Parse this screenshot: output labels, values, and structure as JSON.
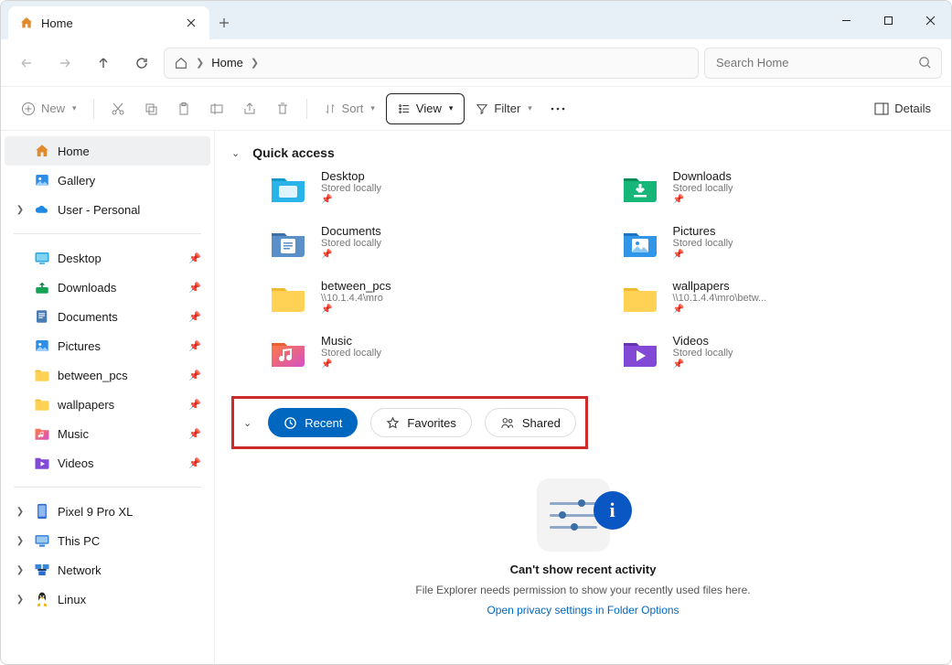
{
  "titlebar": {
    "tab_title": "Home"
  },
  "breadcrumb": {
    "crumb1": "Home"
  },
  "search": {
    "placeholder": "Search Home"
  },
  "toolbar": {
    "new_label": "New",
    "sort_label": "Sort",
    "view_label": "View",
    "filter_label": "Filter",
    "details_label": "Details"
  },
  "sidebar": {
    "top": [
      {
        "label": "Home",
        "icon": "home",
        "selected": true
      },
      {
        "label": "Gallery",
        "icon": "gallery"
      },
      {
        "label": "User - Personal",
        "icon": "onedrive",
        "chevron": true
      }
    ],
    "pinned": [
      {
        "label": "Desktop",
        "icon": "desktop"
      },
      {
        "label": "Downloads",
        "icon": "downloads"
      },
      {
        "label": "Documents",
        "icon": "documents"
      },
      {
        "label": "Pictures",
        "icon": "pictures"
      },
      {
        "label": "between_pcs",
        "icon": "folder"
      },
      {
        "label": "wallpapers",
        "icon": "folder"
      },
      {
        "label": "Music",
        "icon": "music"
      },
      {
        "label": "Videos",
        "icon": "videos"
      }
    ],
    "bottom": [
      {
        "label": "Pixel 9 Pro XL",
        "icon": "phone"
      },
      {
        "label": "This PC",
        "icon": "pc"
      },
      {
        "label": "Network",
        "icon": "network"
      },
      {
        "label": "Linux",
        "icon": "linux"
      }
    ]
  },
  "quick_access": {
    "title": "Quick access",
    "items": [
      {
        "name": "Desktop",
        "sub": "Stored locally",
        "icon": "desktop"
      },
      {
        "name": "Downloads",
        "sub": "Stored locally",
        "icon": "downloads"
      },
      {
        "name": "Documents",
        "sub": "Stored locally",
        "icon": "documents"
      },
      {
        "name": "Pictures",
        "sub": "Stored locally",
        "icon": "pictures"
      },
      {
        "name": "between_pcs",
        "sub": "\\\\10.1.4.4\\mro",
        "icon": "folder"
      },
      {
        "name": "wallpapers",
        "sub": "\\\\10.1.4.4\\mro\\betw...",
        "icon": "folder"
      },
      {
        "name": "Music",
        "sub": "Stored locally",
        "icon": "music"
      },
      {
        "name": "Videos",
        "sub": "Stored locally",
        "icon": "videos"
      }
    ]
  },
  "recent_tabs": {
    "recent": "Recent",
    "favorites": "Favorites",
    "shared": "Shared"
  },
  "empty": {
    "title": "Can't show recent activity",
    "sub": "File Explorer needs permission to show your recently used files here.",
    "link": "Open privacy settings in Folder Options"
  }
}
